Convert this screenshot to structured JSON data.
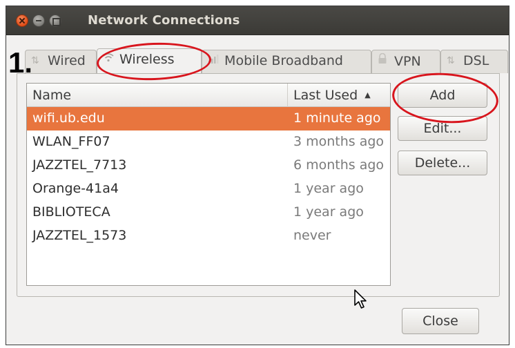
{
  "window": {
    "title": "Network Connections"
  },
  "step_label": "1.",
  "tabs": [
    {
      "label": "Wired",
      "icon": "wired-icon"
    },
    {
      "label": "Wireless",
      "icon": "wifi-icon"
    },
    {
      "label": "Mobile Broadband",
      "icon": "signal-bars-icon"
    },
    {
      "label": "VPN",
      "icon": "lock-icon"
    },
    {
      "label": "DSL",
      "icon": "dsl-icon"
    }
  ],
  "table": {
    "headers": {
      "name": "Name",
      "last_used": "Last Used"
    },
    "rows": [
      {
        "name": "wifi.ub.edu",
        "last_used": "1 minute ago"
      },
      {
        "name": "WLAN_FF07",
        "last_used": "3 months ago"
      },
      {
        "name": "JAZZTEL_7713",
        "last_used": "6 months ago"
      },
      {
        "name": "Orange-41a4",
        "last_used": "1 year ago"
      },
      {
        "name": "BIBLIOTECA",
        "last_used": "1 year ago"
      },
      {
        "name": "JAZZTEL_1573",
        "last_used": "never"
      }
    ]
  },
  "buttons": {
    "add": "Add",
    "edit": "Edit...",
    "delete": "Delete...",
    "close": "Close"
  },
  "colors": {
    "selection": "#e8753e",
    "annotation": "#d8151d",
    "titlebar": "#3c3b37"
  }
}
